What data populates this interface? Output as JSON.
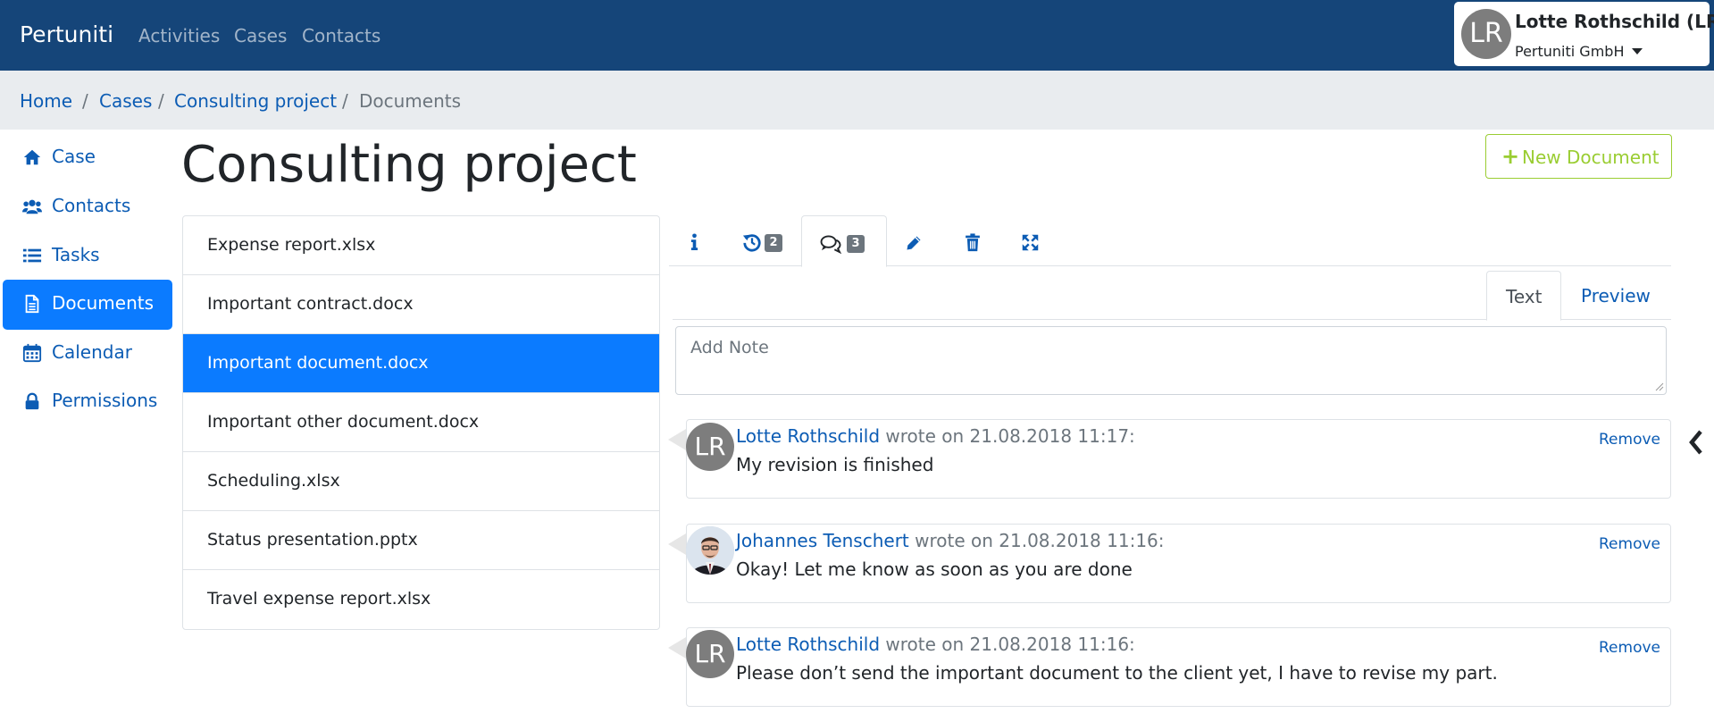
{
  "navbar": {
    "brand": "Pertuniti",
    "links": [
      "Activities",
      "Cases",
      "Contacts"
    ],
    "user": {
      "initials": "LR",
      "name": "Lotte Rothschild (LR)",
      "org": "Pertuniti GmbH"
    }
  },
  "breadcrumb": {
    "items": [
      "Home",
      "Cases",
      "Consulting project",
      "Documents"
    ],
    "separator": "/"
  },
  "sidebar": {
    "items": [
      {
        "label": "Case",
        "icon": "home-icon"
      },
      {
        "label": "Contacts",
        "icon": "users-icon"
      },
      {
        "label": "Tasks",
        "icon": "list-icon"
      },
      {
        "label": "Documents",
        "icon": "document-icon",
        "active": true
      },
      {
        "label": "Calendar",
        "icon": "calendar-icon"
      },
      {
        "label": "Permissions",
        "icon": "lock-icon"
      }
    ]
  },
  "page": {
    "title": "Consulting project",
    "new_document_label": "New Document"
  },
  "documents": {
    "items": [
      "Expense report.xlsx",
      "Important contract.docx",
      "Important document.docx",
      "Important other document.docx",
      "Scheduling.xlsx",
      "Status presentation.pptx",
      "Travel expense report.xlsx"
    ],
    "selected_index": 2
  },
  "detail_tabs": {
    "tabs": [
      {
        "icon": "info-icon"
      },
      {
        "icon": "history-icon",
        "badge": "2"
      },
      {
        "icon": "comments-icon",
        "badge": "3",
        "active": true
      },
      {
        "icon": "pencil-icon"
      },
      {
        "icon": "trash-icon"
      },
      {
        "icon": "expand-icon"
      }
    ]
  },
  "note_editor": {
    "tab_text": "Text",
    "tab_preview": "Preview",
    "placeholder": "Add Note"
  },
  "comments": [
    {
      "initials": "LR",
      "author": "Lotte Rothschild",
      "meta": " wrote on 21.08.2018 11:17:",
      "body": "My revision is finished",
      "remove": "Remove",
      "avatar_type": "initials"
    },
    {
      "initials": "",
      "author": "Johannes Tenschert",
      "meta": " wrote on 21.08.2018 11:16:",
      "body": "Okay! Let me know as soon as you are done",
      "remove": "Remove",
      "avatar_type": "photo"
    },
    {
      "initials": "LR",
      "author": "Lotte Rothschild",
      "meta": " wrote on 21.08.2018 11:16:",
      "body": "Please don’t send the important document to the client yet, I have to revise my part.",
      "remove": "Remove",
      "avatar_type": "initials"
    }
  ],
  "colors": {
    "navbar": "#154579",
    "primary": "#0b7bff",
    "link": "#0c5cb4",
    "success_outline": "#9acd32",
    "avatar_gray": "#7d7d7d"
  }
}
